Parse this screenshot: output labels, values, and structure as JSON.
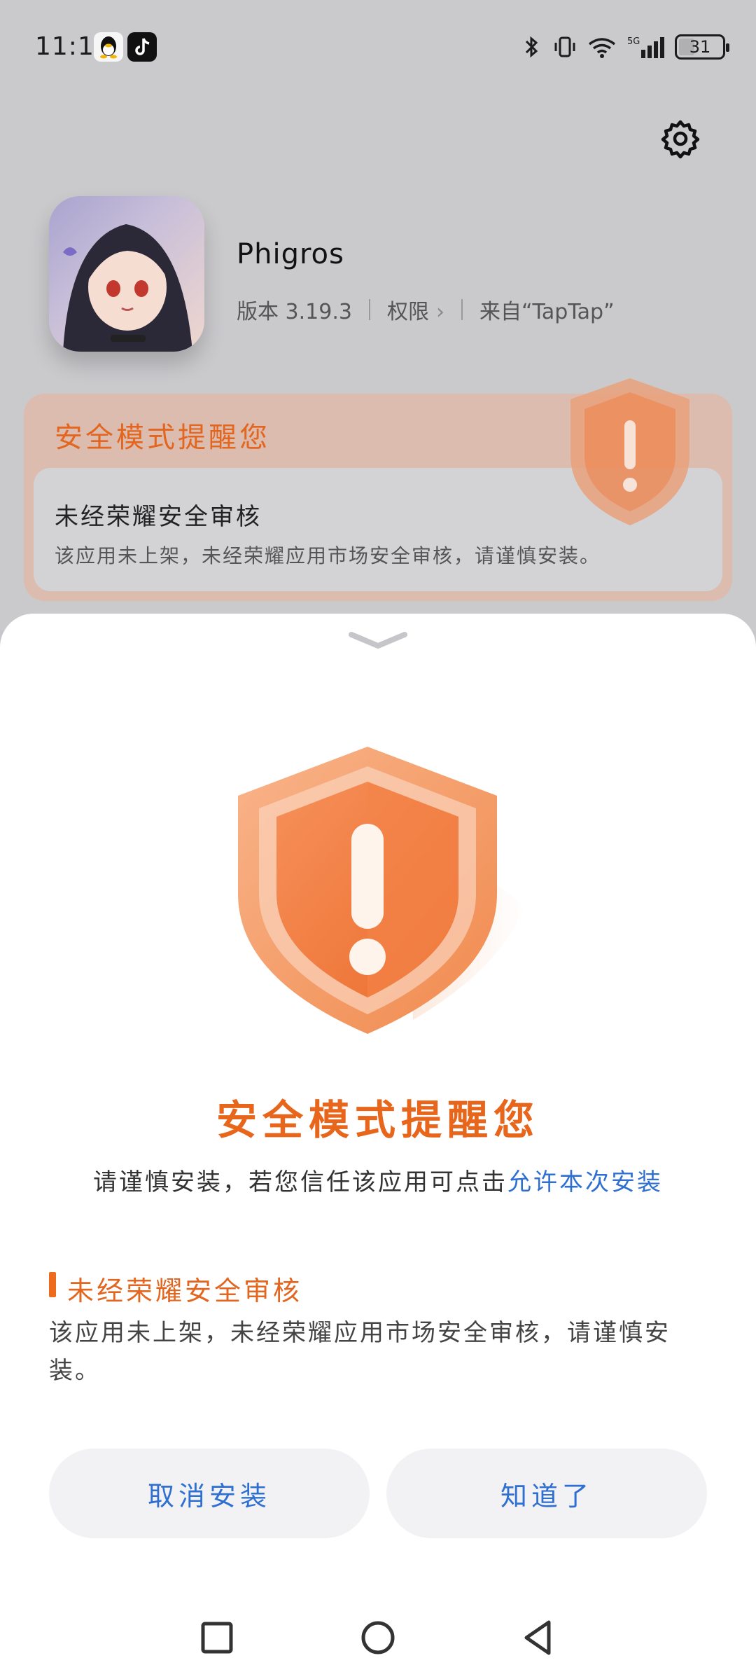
{
  "status_bar": {
    "time": "11:18",
    "notifications": [
      "qq-icon",
      "tiktok-icon"
    ],
    "indicators": [
      "bluetooth-icon",
      "vibrate-icon",
      "wifi-icon",
      "5g-signal-icon"
    ],
    "network": "5G",
    "battery": "31"
  },
  "app": {
    "name": "Phigros",
    "version_label": "版本 3.19.3",
    "permissions_label": "权限",
    "source_label": "来自“TapTap”"
  },
  "background_card": {
    "title": "安全模式提醒您",
    "inner_title": "未经荣耀安全审核",
    "inner_desc": "该应用未上架，未经荣耀应用市场安全审核，请谨慎安装。"
  },
  "sheet": {
    "title": "安全模式提醒您",
    "subtitle_prefix": "请谨慎安装，若您信任该应用可点击",
    "subtitle_link": "允许本次安装",
    "reason_title": "未经荣耀安全审核",
    "reason_desc": "该应用未上架，未经荣耀应用市场安全审核，请谨慎安装。",
    "cancel_label": "取消安装",
    "ok_label": "知道了"
  },
  "colors": {
    "accent_orange": "#e8661c",
    "link_blue": "#2e6fd1"
  }
}
